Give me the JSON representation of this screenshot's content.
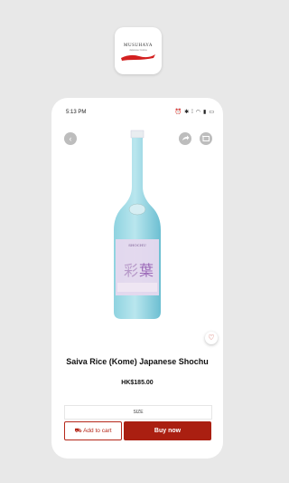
{
  "brand": {
    "logo_name": "MUSUHAYA",
    "logo_sub": "Japanese Cuisine"
  },
  "status_bar": {
    "time": "5:13 PM"
  },
  "product": {
    "name": "Saiva Rice (Kome) Japanese Shochu",
    "price": "HK$185.00",
    "size_label": "SIZE"
  },
  "actions": {
    "add_to_cart": "Add to cart",
    "buy_now": "Buy now"
  },
  "icons": {
    "back": "chevron-left-icon",
    "share": "share-icon",
    "cart": "cart-icon",
    "favorite": "heart-icon"
  },
  "colors": {
    "accent": "#aa1f11",
    "bottle": "#7fc6d6"
  }
}
